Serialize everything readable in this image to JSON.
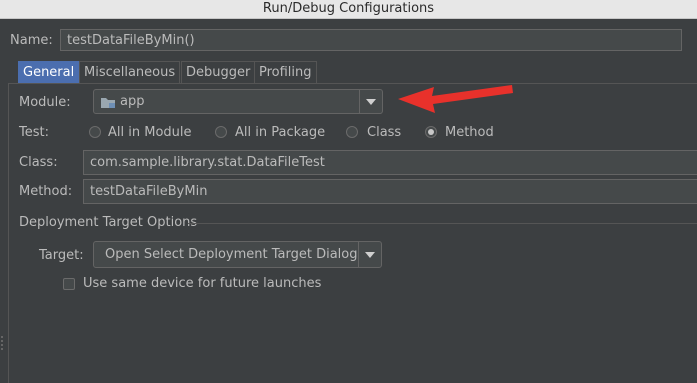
{
  "window": {
    "title": "Run/Debug Configurations"
  },
  "name_row": {
    "label": "Name:",
    "value": "testDataFileByMin()"
  },
  "tabs": [
    {
      "label": "General",
      "selected": true
    },
    {
      "label": "Miscellaneous",
      "selected": false
    },
    {
      "label": "Debugger",
      "selected": false
    },
    {
      "label": "Profiling",
      "selected": false
    }
  ],
  "module": {
    "label": "Module:",
    "value": "app",
    "icon": "folder-icon"
  },
  "test": {
    "label": "Test:",
    "options": [
      {
        "label": "All in Module",
        "checked": false
      },
      {
        "label": "All in Package",
        "checked": false
      },
      {
        "label": "Class",
        "checked": false
      },
      {
        "label": "Method",
        "checked": true
      }
    ]
  },
  "class_row": {
    "label": "Class:",
    "value": "com.sample.library.stat.DataFileTest"
  },
  "method_row": {
    "label": "Method:",
    "value": "testDataFileByMin"
  },
  "deployment": {
    "section_title": "Deployment Target Options",
    "target_label": "Target:",
    "target_value": "Open Select Deployment Target Dialog",
    "same_device_label": "Use same device for future launches",
    "same_device_checked": false
  },
  "annotation": {
    "color": "#e8312b"
  }
}
